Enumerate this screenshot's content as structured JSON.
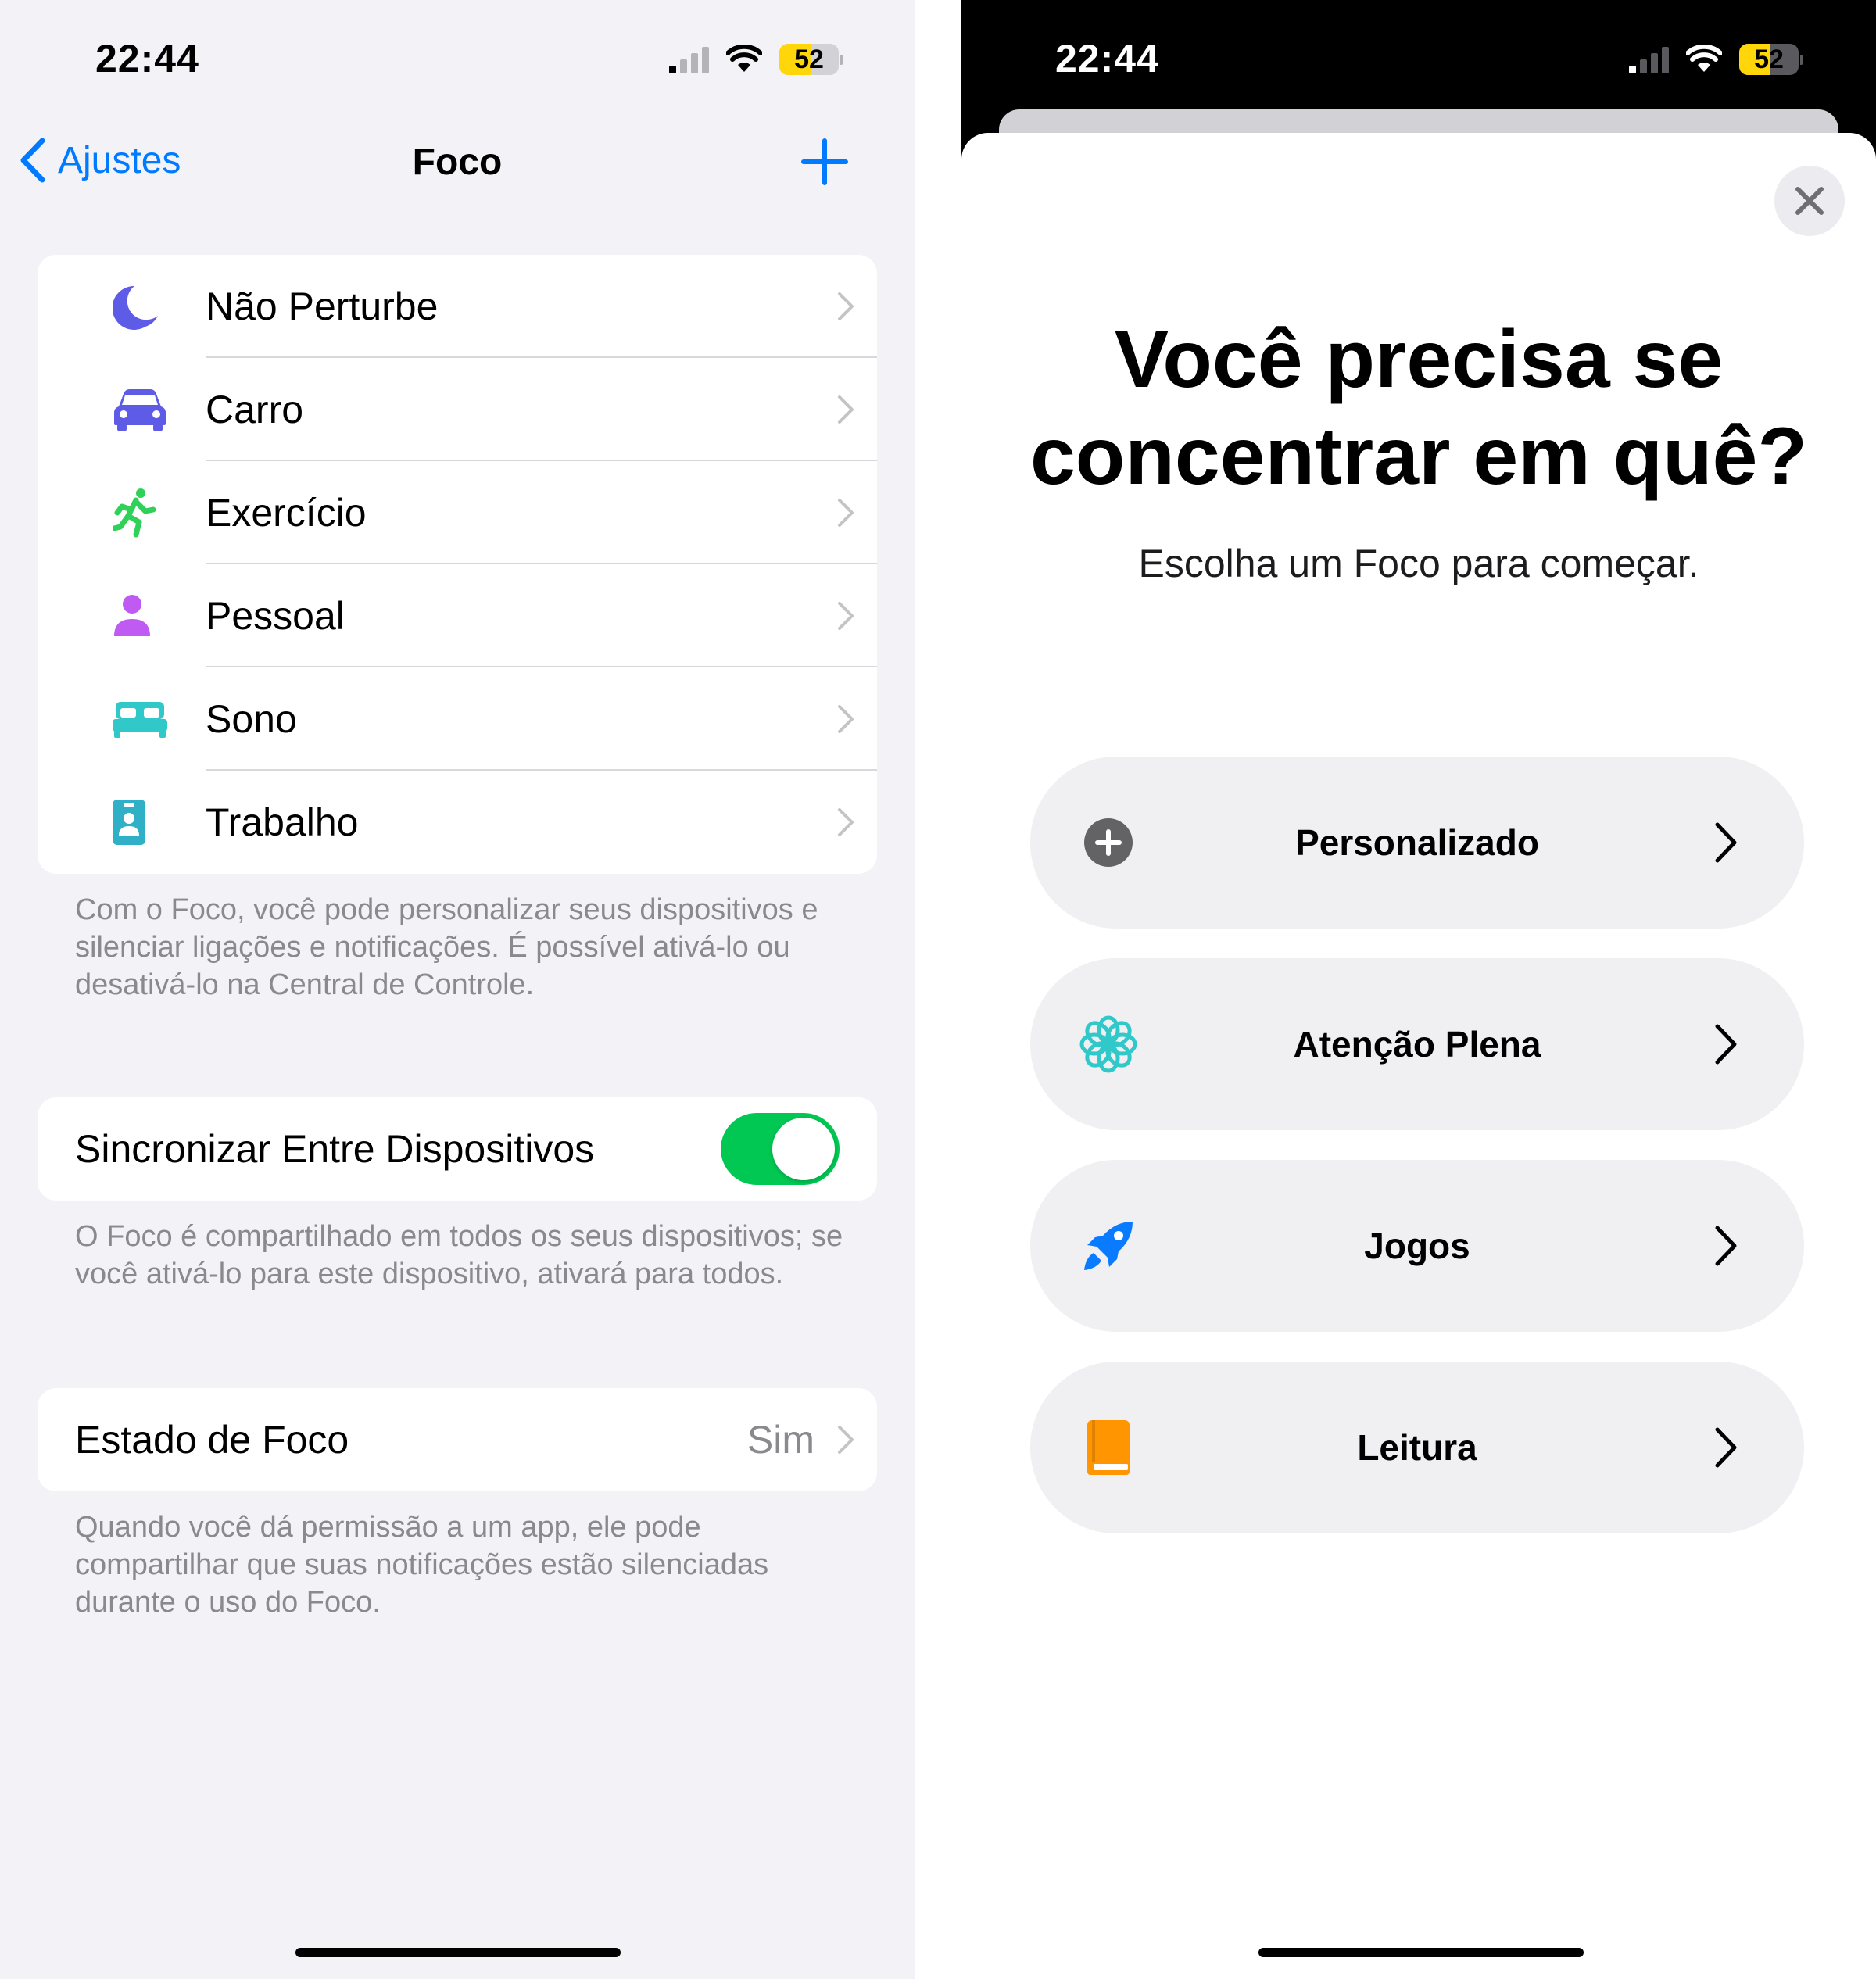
{
  "left": {
    "status": {
      "time": "22:44",
      "battery": "52"
    },
    "nav": {
      "back_label": "Ajustes",
      "title": "Foco"
    },
    "focus_items": [
      {
        "label": "Não Perturbe",
        "icon": "moon-icon",
        "color": "#5e5ce6"
      },
      {
        "label": "Carro",
        "icon": "car-icon",
        "color": "#5e5ce6"
      },
      {
        "label": "Exercício",
        "icon": "running-figure-icon",
        "color": "#30d158"
      },
      {
        "label": "Pessoal",
        "icon": "person-icon",
        "color": "#bf5af2"
      },
      {
        "label": "Sono",
        "icon": "bed-icon",
        "color": "#30c8c8"
      },
      {
        "label": "Trabalho",
        "icon": "id-badge-icon",
        "color": "#30b0c7"
      }
    ],
    "focus_note": "Com o Foco, você pode personalizar seus dispositivos e silenciar ligações e notificações. É possível ativá-lo ou desativá-lo na Central de Controle.",
    "sync": {
      "label": "Sincronizar Entre Dispositivos",
      "on": true
    },
    "sync_note": "O Foco é compartilhado em todos os seus dispositivos; se você ativá-lo para este dispositivo, ativará para todos.",
    "state": {
      "label": "Estado de Foco",
      "value": "Sim"
    },
    "state_note": "Quando você dá permissão a um app, ele pode compartilhar que suas notificações estão silenciadas durante o uso do Foco."
  },
  "right": {
    "status": {
      "time": "22:44",
      "battery": "52"
    },
    "headline_line1": "Você precisa se",
    "headline_line2": "concentrar em quê?",
    "subheadline": "Escolha um Foco para começar.",
    "options": [
      {
        "label": "Personalizado",
        "icon": "plus-circle-icon",
        "color": "#636366"
      },
      {
        "label": "Atenção Plena",
        "icon": "flower-icon",
        "color": "#30c8c8"
      },
      {
        "label": "Jogos",
        "icon": "rocket-icon",
        "color": "#0a7aff"
      },
      {
        "label": "Leitura",
        "icon": "book-icon",
        "color": "#ff9500"
      }
    ]
  },
  "colors": {
    "accent": "#007aff",
    "toggle_on": "#00c853",
    "battery_yellow": "#ffd60a"
  }
}
